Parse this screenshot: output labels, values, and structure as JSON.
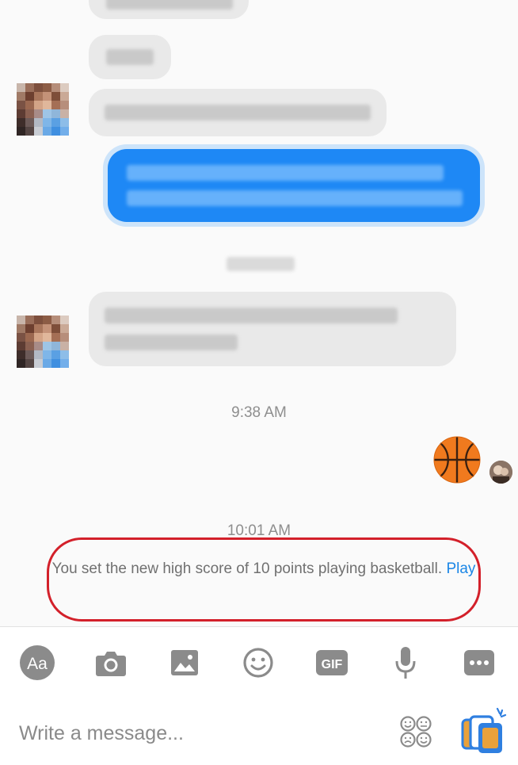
{
  "timestamps": {
    "first": "9:38 AM",
    "second": "10:01 AM"
  },
  "game_notification": {
    "text": "You set the new high score of 10 points playing basketball.",
    "link": "Play"
  },
  "toolbar": {
    "text_button_label": "Aa",
    "gif_label": "GIF",
    "icons": [
      "text-size-icon",
      "camera-icon",
      "image-icon",
      "emoji-icon",
      "gif-icon",
      "microphone-icon",
      "more-icon"
    ]
  },
  "composer": {
    "placeholder": "Write a message..."
  },
  "colors": {
    "outgoing_bubble": "#1e88f5",
    "incoming_bubble": "#e9e9e9",
    "link": "#1a86e6",
    "highlight_border": "#d3202a",
    "icon_gray": "#8b8b8b"
  }
}
